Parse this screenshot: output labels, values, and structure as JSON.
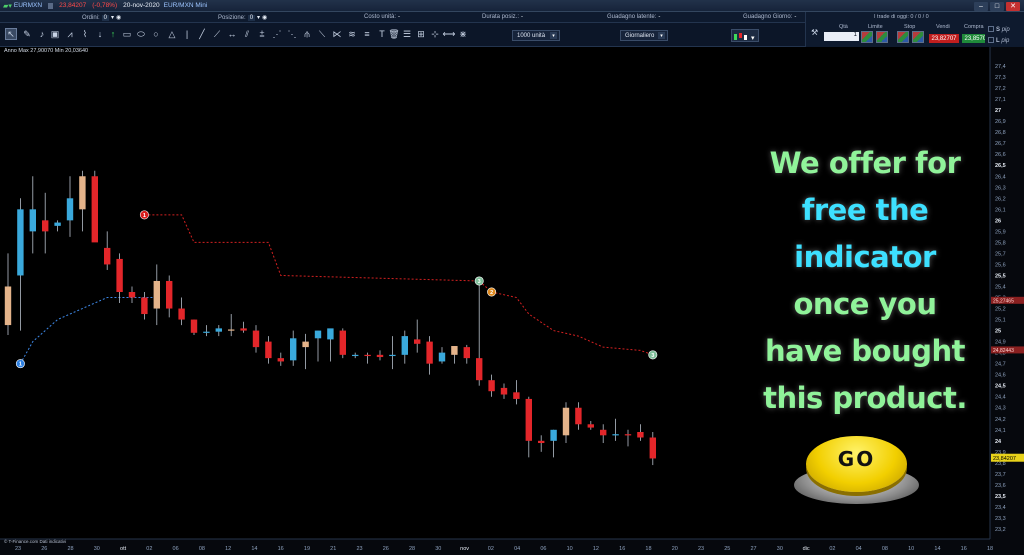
{
  "titlebar": {
    "symbol": "EURMXN",
    "last_price": "23,84207",
    "change": "(-0,78%)",
    "date": "20-nov-2020",
    "instrument": "EUR/MXN Mini"
  },
  "inforow": {
    "orders_label": "Ordini:",
    "orders_value": "0",
    "position_label": "Posizione:",
    "position_value": "0",
    "unit_cost_label": "Costo unità:",
    "unit_cost_value": "-",
    "duration_label": "Durata posiz.:",
    "duration_value": "-",
    "latent_gain_label": "Guadagno latente:",
    "latent_gain_value": "-",
    "day_gain_label": "Guadagno Giorno:",
    "day_gain_value": "-",
    "trades_today": "I trade di oggi: 0 / 0 / 0"
  },
  "toolbar": {
    "units_dropdown": "1000 unità",
    "period_dropdown": "Giornaliero"
  },
  "orderpanel": {
    "qty_label": "Qtà",
    "qty_value": "1",
    "limit_label": "Limite",
    "stop_label": "Stop",
    "sell_label": "Vendi",
    "buy_label": "Compra",
    "sell_price": "23,82707",
    "buy_price": "23,85707"
  },
  "sidebox": {
    "s_label": "S",
    "l_label": "L",
    "pip": "pip"
  },
  "chart_anno": "Anno Max 27,90070 Min 20,03640",
  "source": "© T-Finance.com Dati indicativi",
  "promo": {
    "lines": [
      "We offer for",
      "free the",
      "indicator",
      "once you",
      "have bought",
      "this product."
    ],
    "go_label": "GO"
  },
  "chart_data": {
    "type": "candlestick",
    "ylim": [
      23.2,
      27.5
    ],
    "y_ticks": [
      "27,4",
      "27,3",
      "27,2",
      "27,1",
      "27",
      "26,9",
      "26,8",
      "26,7",
      "26,6",
      "26,5",
      "26,4",
      "26,3",
      "26,2",
      "26,1",
      "26",
      "25,9",
      "25,8",
      "25,7",
      "25,6",
      "25,5",
      "25,4",
      "25,3",
      "25,2",
      "25,1",
      "25",
      "24,9",
      "24,8",
      "24,7",
      "24,6",
      "24,5",
      "24,4",
      "24,3",
      "24,2",
      "24,1",
      "24",
      "23,9",
      "23,8",
      "23,7",
      "23,6",
      "23,5",
      "23,4",
      "23,3",
      "23,2"
    ],
    "x_ticks": [
      "23",
      "26",
      "28",
      "30",
      "ott",
      "02",
      "06",
      "08",
      "12",
      "14",
      "16",
      "19",
      "21",
      "23",
      "26",
      "28",
      "30",
      "nov",
      "02",
      "04",
      "06",
      "10",
      "12",
      "16",
      "18",
      "20",
      "23",
      "25",
      "27",
      "30",
      "dic",
      "02",
      "04",
      "08",
      "10",
      "14",
      "16",
      "18"
    ],
    "price_marker": "23,84207",
    "level_markers": [
      "25,27465",
      "24,82443"
    ],
    "candles": [
      {
        "o": 25.05,
        "h": 25.7,
        "l": 24.96,
        "c": 25.4
      },
      {
        "o": 25.5,
        "h": 26.2,
        "l": 25.0,
        "c": 26.1
      },
      {
        "o": 25.9,
        "h": 26.4,
        "l": 25.7,
        "c": 26.1
      },
      {
        "o": 26.0,
        "h": 26.25,
        "l": 25.7,
        "c": 25.9
      },
      {
        "o": 25.95,
        "h": 26.0,
        "l": 25.9,
        "c": 25.98
      },
      {
        "o": 26.0,
        "h": 26.4,
        "l": 25.85,
        "c": 26.2
      },
      {
        "o": 26.1,
        "h": 26.45,
        "l": 25.9,
        "c": 26.4
      },
      {
        "o": 26.4,
        "h": 26.45,
        "l": 25.9,
        "c": 25.8
      },
      {
        "o": 25.75,
        "h": 25.9,
        "l": 25.55,
        "c": 25.6
      },
      {
        "o": 25.65,
        "h": 25.7,
        "l": 25.25,
        "c": 25.35
      },
      {
        "o": 25.35,
        "h": 25.4,
        "l": 25.25,
        "c": 25.3
      },
      {
        "o": 25.3,
        "h": 25.35,
        "l": 25.1,
        "c": 25.15
      },
      {
        "o": 25.2,
        "h": 25.6,
        "l": 25.05,
        "c": 25.45
      },
      {
        "o": 25.45,
        "h": 25.5,
        "l": 25.12,
        "c": 25.2
      },
      {
        "o": 25.2,
        "h": 25.3,
        "l": 25.05,
        "c": 25.1
      },
      {
        "o": 25.1,
        "h": 25.1,
        "l": 24.96,
        "c": 24.98
      },
      {
        "o": 24.99,
        "h": 25.05,
        "l": 24.95,
        "c": 24.99
      },
      {
        "o": 24.99,
        "h": 25.05,
        "l": 24.95,
        "c": 25.02
      },
      {
        "o": 25.01,
        "h": 25.15,
        "l": 24.95,
        "c": 25.01
      },
      {
        "o": 25.02,
        "h": 25.08,
        "l": 24.98,
        "c": 25.0
      },
      {
        "o": 25.0,
        "h": 25.05,
        "l": 24.8,
        "c": 24.85
      },
      {
        "o": 24.9,
        "h": 24.95,
        "l": 24.7,
        "c": 24.75
      },
      {
        "o": 24.75,
        "h": 24.8,
        "l": 24.68,
        "c": 24.72
      },
      {
        "o": 24.73,
        "h": 25.0,
        "l": 24.68,
        "c": 24.93
      },
      {
        "o": 24.85,
        "h": 24.97,
        "l": 24.65,
        "c": 24.9
      },
      {
        "o": 24.93,
        "h": 25.0,
        "l": 24.72,
        "c": 25.0
      },
      {
        "o": 24.92,
        "h": 25.0,
        "l": 24.72,
        "c": 25.02
      },
      {
        "o": 25.0,
        "h": 25.02,
        "l": 24.75,
        "c": 24.78
      },
      {
        "o": 24.78,
        "h": 24.8,
        "l": 24.75,
        "c": 24.78
      },
      {
        "o": 24.78,
        "h": 24.8,
        "l": 24.7,
        "c": 24.77
      },
      {
        "o": 24.78,
        "h": 24.82,
        "l": 24.73,
        "c": 24.76
      },
      {
        "o": 24.77,
        "h": 24.95,
        "l": 24.65,
        "c": 24.78
      },
      {
        "o": 24.78,
        "h": 25.0,
        "l": 24.7,
        "c": 24.95
      },
      {
        "o": 24.92,
        "h": 25.1,
        "l": 24.8,
        "c": 24.88
      },
      {
        "o": 24.9,
        "h": 24.95,
        "l": 24.6,
        "c": 24.7
      },
      {
        "o": 24.72,
        "h": 24.85,
        "l": 24.7,
        "c": 24.8
      },
      {
        "o": 24.78,
        "h": 24.86,
        "l": 24.7,
        "c": 24.86
      },
      {
        "o": 24.85,
        "h": 24.87,
        "l": 24.7,
        "c": 24.75
      },
      {
        "o": 24.75,
        "h": 25.45,
        "l": 24.5,
        "c": 24.55
      },
      {
        "o": 24.55,
        "h": 24.6,
        "l": 24.4,
        "c": 24.45
      },
      {
        "o": 24.48,
        "h": 24.52,
        "l": 24.38,
        "c": 24.42
      },
      {
        "o": 24.44,
        "h": 24.55,
        "l": 24.33,
        "c": 24.38
      },
      {
        "o": 24.38,
        "h": 24.4,
        "l": 23.85,
        "c": 24.0
      },
      {
        "o": 24.0,
        "h": 24.05,
        "l": 23.9,
        "c": 23.98
      },
      {
        "o": 24.0,
        "h": 24.1,
        "l": 23.85,
        "c": 24.1
      },
      {
        "o": 24.05,
        "h": 24.35,
        "l": 23.98,
        "c": 24.3
      },
      {
        "o": 24.3,
        "h": 24.35,
        "l": 24.1,
        "c": 24.15
      },
      {
        "o": 24.15,
        "h": 24.18,
        "l": 24.1,
        "c": 24.12
      },
      {
        "o": 24.1,
        "h": 24.15,
        "l": 23.98,
        "c": 24.05
      },
      {
        "o": 24.05,
        "h": 24.2,
        "l": 24.0,
        "c": 24.06
      },
      {
        "o": 24.06,
        "h": 24.1,
        "l": 23.95,
        "c": 24.05
      },
      {
        "o": 24.08,
        "h": 24.15,
        "l": 24.0,
        "c": 24.03
      },
      {
        "o": 24.03,
        "h": 24.08,
        "l": 23.78,
        "c": 23.84
      }
    ],
    "trailing_upper": [
      {
        "i": 11,
        "y": 26.05
      },
      {
        "i": 14,
        "y": 26.05
      },
      {
        "i": 15,
        "y": 25.8
      },
      {
        "i": 21,
        "y": 25.8
      },
      {
        "i": 22,
        "y": 25.5
      },
      {
        "i": 38,
        "y": 25.45
      },
      {
        "i": 39,
        "y": 25.35
      },
      {
        "i": 41,
        "y": 25.3
      },
      {
        "i": 42,
        "y": 25.15
      },
      {
        "i": 44,
        "y": 25.0
      },
      {
        "i": 46,
        "y": 24.95
      },
      {
        "i": 48,
        "y": 24.85
      },
      {
        "i": 51,
        "y": 24.82
      },
      {
        "i": 52,
        "y": 24.78
      }
    ],
    "trailing_lower": [
      {
        "i": 1,
        "y": 24.7
      },
      {
        "i": 2,
        "y": 24.9
      },
      {
        "i": 3,
        "y": 25.0
      },
      {
        "i": 4,
        "y": 25.1
      },
      {
        "i": 6,
        "y": 25.2
      },
      {
        "i": 8,
        "y": 25.3
      },
      {
        "i": 12,
        "y": 25.3
      }
    ],
    "signals": [
      {
        "n": "1",
        "i": 1,
        "y": 24.7,
        "color": "#2d7fe0"
      },
      {
        "n": "1",
        "i": 11,
        "y": 26.05,
        "color": "#d91e1e"
      },
      {
        "n": "3",
        "i": 38,
        "y": 25.45,
        "color": "#7fbf9a"
      },
      {
        "n": "2",
        "i": 39,
        "y": 25.35,
        "color": "#e08a1e"
      },
      {
        "n": "3",
        "i": 52,
        "y": 24.78,
        "color": "#7fbf9a"
      }
    ],
    "colors": {
      "bull": "#3aa9dc",
      "bull_alt": "#e4b38a",
      "bear": "#e3262a",
      "trail_upper": "#d22020",
      "trail_lower": "#3d88e6",
      "axis_text": "#8fa3c0",
      "axis_bold": "#e6ecf5"
    }
  }
}
